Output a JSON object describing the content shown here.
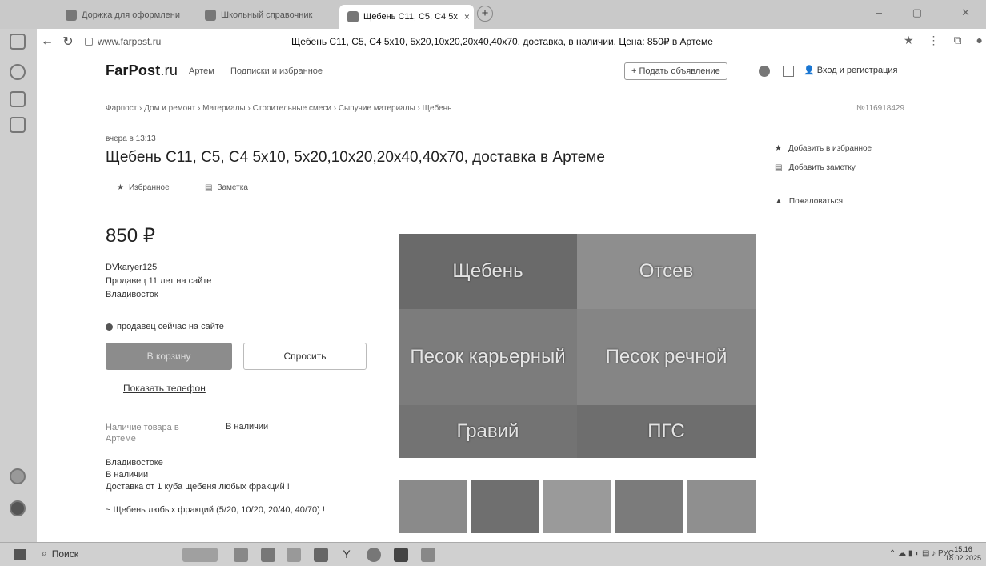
{
  "browser": {
    "tabs": [
      {
        "label": "Доржка для оформлени"
      },
      {
        "label": "Школьный справочник"
      },
      {
        "label": "Щебень С11, С5, С4 5х"
      }
    ],
    "url": "www.farpost.ru",
    "page_title": "Щебень С11, С5, С4 5х10, 5х20,10х20,20х40,40х70, доставка, в наличии. Цена: 850₽ в Артеме"
  },
  "header": {
    "logo_main": "FarPost",
    "logo_suffix": ".ru",
    "city": "Артем",
    "subscriptions": "Подписки и избранное",
    "post_ad": "+ Подать объявление",
    "login": "Вход и регистрация"
  },
  "breadcrumb": "Фарпост › Дом и ремонт › Материалы › Строительные смеси › Сыпучие материалы › Щебень",
  "ad_number": "№116918429",
  "listing": {
    "posted": "вчера в 13:13",
    "title": "Щебень С11, С5, С4 5х10, 5х20,10х20,20х40,40х70, доставка в Артеме",
    "favorite": "Избранное",
    "note": "Заметка",
    "price": "850 ₽",
    "seller_name": "DVkaryer125",
    "seller_since": "Продавец 11 лет на сайте",
    "seller_city": "Владивосток",
    "online_status": "продавец сейчас на сайте",
    "cart_button": "В корзину",
    "ask_button": "Спросить",
    "show_phone": "Показать телефон",
    "availability_label": "Наличие товара в Артеме",
    "availability_value": "В наличии",
    "description": {
      "line1": "Владивостоке",
      "line2": "В наличии",
      "line3": "Доставка от 1 куба щебеня любых фракций !",
      "line4": "~ Щебень любых фракций (5/20, 10/20, 20/40, 40/70) !"
    }
  },
  "side_actions": {
    "add_favorite": "Добавить в избранное",
    "add_note": "Добавить заметку",
    "complain": "Пожаловаться"
  },
  "gallery": {
    "captions": {
      "c1": "Щебень",
      "c2": "Отсев",
      "c3": "Песок карьерный",
      "c4": "Песок речной",
      "c5": "Гравий",
      "c6": "ПГС"
    }
  },
  "taskbar": {
    "search": "Поиск",
    "lang": "РУС",
    "time": "15:16",
    "date": "18.02.2025"
  }
}
